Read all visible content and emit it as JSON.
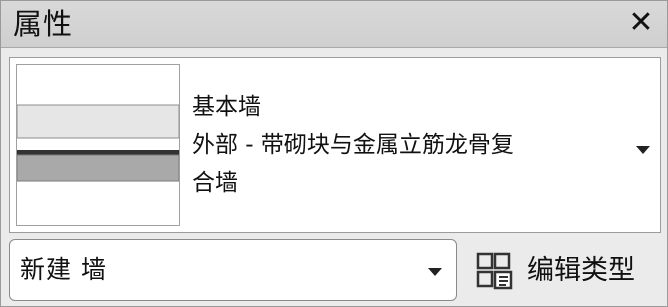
{
  "panel": {
    "title": "属性",
    "close_glyph": "✕"
  },
  "type_selector": {
    "family": "基本墙",
    "type_line1": "外部 - 带砌块与金属立筋龙骨复",
    "type_line2": "合墙",
    "dropdown_icon": "triangle-down"
  },
  "filter": {
    "value": "新建 墙"
  },
  "edit_type": {
    "label": "编辑类型",
    "icon": "edit-type-icon"
  }
}
